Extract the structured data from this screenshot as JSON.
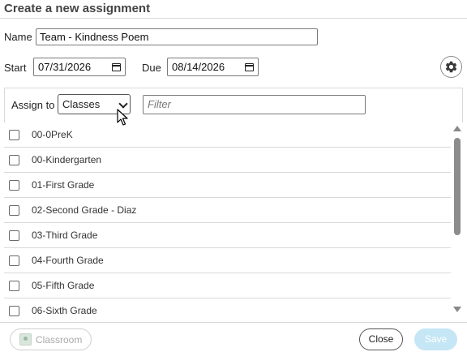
{
  "dialog": {
    "title": "Create a new assignment"
  },
  "form": {
    "name_label": "Name",
    "name_value": "Team - Kindness Poem",
    "start_label": "Start",
    "start_value": "07/31/2026",
    "due_label": "Due",
    "due_value": "08/14/2026"
  },
  "assign": {
    "label": "Assign to",
    "selected": "Classes",
    "filter_placeholder": "Filter"
  },
  "classes": [
    {
      "label": "00-0PreK",
      "checked": false
    },
    {
      "label": "00-Kindergarten",
      "checked": false
    },
    {
      "label": "01-First Grade",
      "checked": false
    },
    {
      "label": "02-Second Grade - Diaz",
      "checked": false
    },
    {
      "label": "03-Third Grade",
      "checked": false
    },
    {
      "label": "04-Fourth Grade",
      "checked": false
    },
    {
      "label": "05-Fifth Grade",
      "checked": false
    },
    {
      "label": "06-Sixth Grade",
      "checked": false
    }
  ],
  "footer": {
    "classroom_label": "Classroom",
    "close_label": "Close",
    "save_label": "Save"
  },
  "icons": {
    "settings": "gear-icon",
    "calendar": "calendar-icon",
    "select": "chevron-down-icon",
    "classroom": "google-classroom-icon",
    "pointer": "mouse-pointer-icon"
  },
  "colors": {
    "save_disabled": "#c5e6f5",
    "border": "#d9d9d9",
    "scroll_thumb": "#8c8c8c"
  }
}
